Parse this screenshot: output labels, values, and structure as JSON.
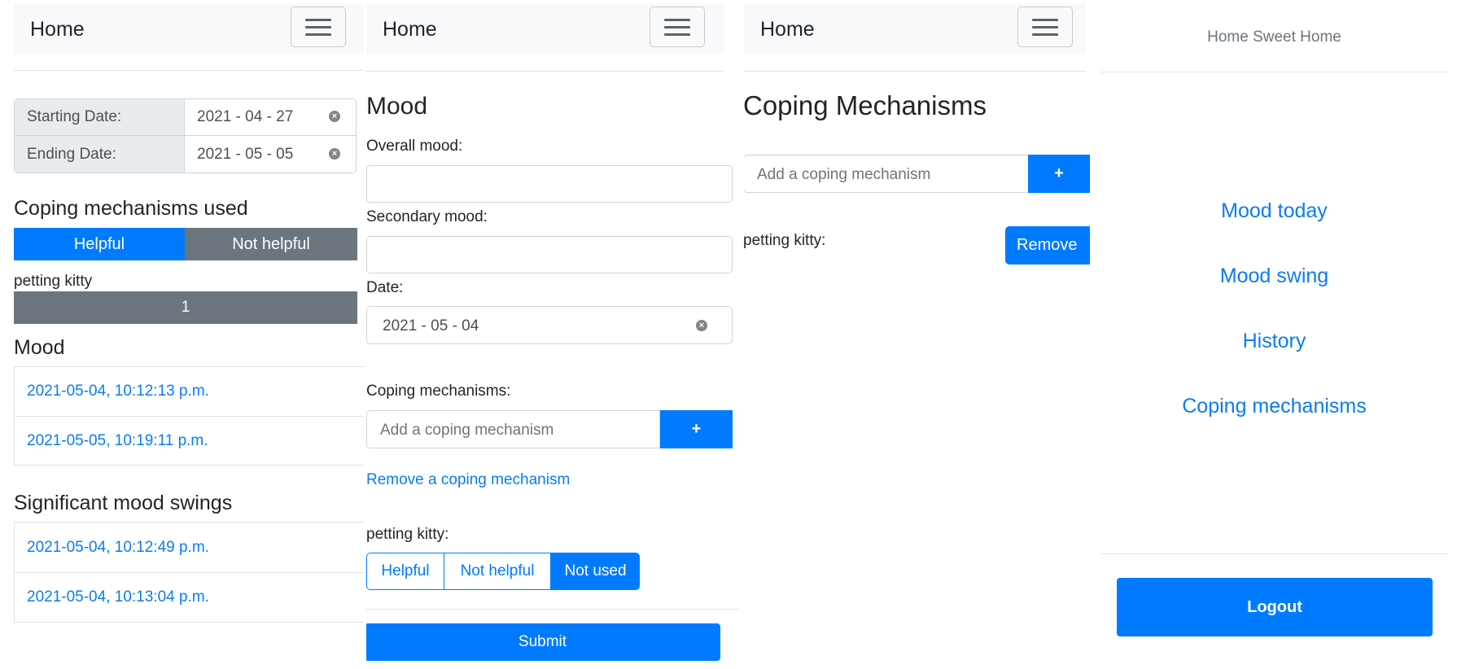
{
  "panel1": {
    "nav": {
      "brand": "Home"
    },
    "starting_date": {
      "label": "Starting Date:",
      "value": "2021 - 04 - 27"
    },
    "ending_date": {
      "label": "Ending Date:",
      "value": "2021 - 05 - 05"
    },
    "coping_title": "Coping mechanisms used",
    "tabs": {
      "helpful": "Helpful",
      "not_helpful": "Not helpful"
    },
    "coping_item": {
      "name": "petting kitty",
      "count": "1"
    },
    "mood_title": "Mood",
    "mood_entries": [
      "2021-05-04, 10:12:13 p.m.",
      "2021-05-05, 10:19:11 p.m."
    ],
    "swings_title": "Significant mood swings",
    "swing_entries": [
      "2021-05-04, 10:12:49 p.m.",
      "2021-05-04, 10:13:04 p.m."
    ]
  },
  "panel2": {
    "nav": {
      "brand": "Home"
    },
    "title": "Mood",
    "overall_label": "Overall mood:",
    "secondary_label": "Secondary mood:",
    "date_label": "Date:",
    "date_value": "2021 - 05 - 04",
    "coping_label": "Coping mechanisms:",
    "add_placeholder": "Add a coping mechanism",
    "add_button": "+",
    "remove_link": "Remove a coping mechanism",
    "item_label": "petting kitty:",
    "options": [
      "Helpful",
      "Not helpful",
      "Not used"
    ],
    "submit": "Submit"
  },
  "panel3": {
    "nav": {
      "brand": "Home"
    },
    "title": "Coping Mechanisms",
    "add_placeholder": "Add a coping mechanism",
    "add_button": "+",
    "item_label": "petting kitty:",
    "remove_button": "Remove"
  },
  "panel4": {
    "header": "Home Sweet Home",
    "menu": [
      "Mood today",
      "Mood swing",
      "History",
      "Coping mechanisms"
    ],
    "logout": "Logout"
  },
  "colors": {
    "primary": "#007bff",
    "secondary": "#6c757d",
    "link": "#0a7cf2",
    "navbar_bg": "#f8f9fa"
  },
  "icons": [
    "menu-icon",
    "clear-icon"
  ]
}
